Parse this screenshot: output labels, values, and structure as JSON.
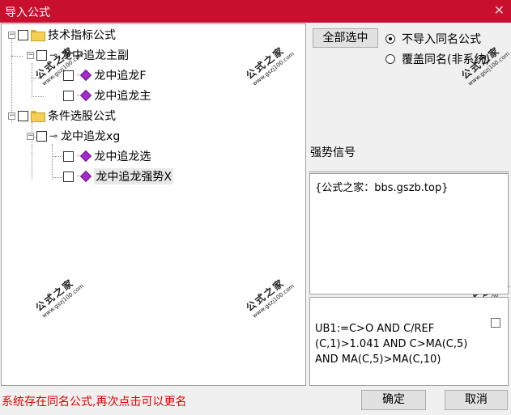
{
  "window": {
    "title": "导入公式",
    "close_glyph": "✕"
  },
  "tree": {
    "groups": [
      {
        "label": "技术指标公式",
        "expander": "−"
      },
      {
        "label": "条件选股公式",
        "expander": "−"
      }
    ],
    "formulas": [
      {
        "label": "龙中追龙主副",
        "expander": "−"
      },
      {
        "label": "龙中追龙xg",
        "expander": "−"
      }
    ],
    "items": [
      {
        "label": "龙中追龙F"
      },
      {
        "label": "龙中追龙主"
      },
      {
        "label": "龙中追龙选"
      },
      {
        "label": "龙中追龙强势X"
      }
    ]
  },
  "watermark": {
    "main": "公式之家",
    "url": "www.gszj100.com"
  },
  "options": {
    "select_all": "全部选中",
    "radio_skip": "不导入同名公式",
    "radio_overwrite": "覆盖同名(非系统)"
  },
  "formula_name": "强势信号",
  "description": "{公式之家：bbs.gszb.top}",
  "formula_code": [
    "UB1:=C>O AND C/REF",
    "(C,1)>1.041 AND C>MA(C,5)",
    "AND MA(C,5)>MA(C,10)"
  ],
  "status_message": "系统存在同名公式,再次点击可以更名",
  "buttons": {
    "ok": "确定",
    "cancel": "取消"
  }
}
